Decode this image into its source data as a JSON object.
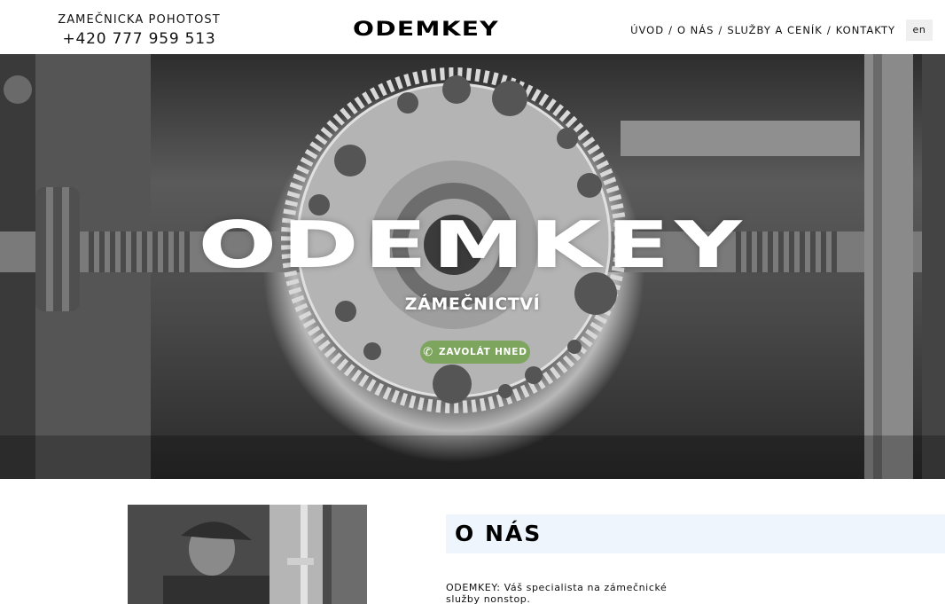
{
  "header": {
    "emergency_label": "ZAMEČNICKA POHOTOST",
    "phone": "+420 777 959 513",
    "logo": "ODEMKEY",
    "nav": [
      {
        "label": "ÚVOD"
      },
      {
        "label": "O NÁS"
      },
      {
        "label": "SLUŽBY A CENÍK"
      },
      {
        "label": "KONTAKTY"
      }
    ],
    "nav_separator": "/",
    "language": "en"
  },
  "hero": {
    "title": "ODEMKEY",
    "subtitle": "ZÁMEČNICTVÍ",
    "call_button": "ZAVOLÁT HNED",
    "call_icon": "phone-icon",
    "button_color": "#7ea55e"
  },
  "about": {
    "heading": "O NÁS",
    "heading_bg": "#eef5fd",
    "text": "ODEMKEY: Váš specialista na zámečnické služby nonstop."
  }
}
